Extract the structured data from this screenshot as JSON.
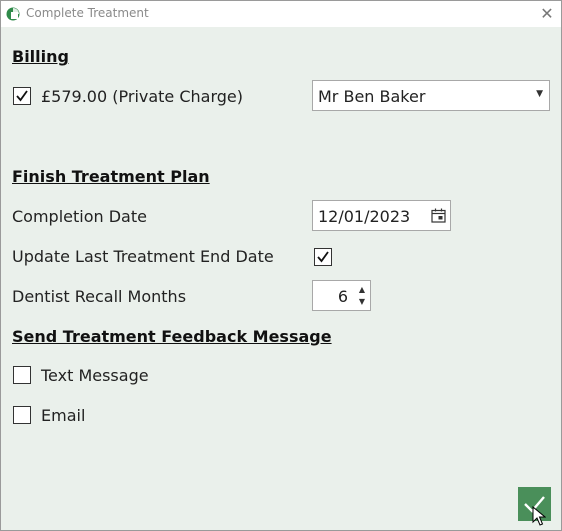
{
  "window": {
    "title": "Complete Treatment",
    "close_glyph": "✕",
    "app_icon": "app-logo-icon"
  },
  "billing": {
    "heading": "Billing",
    "charge_checked": true,
    "charge_label": "£579.00 (Private Charge)",
    "patient_selected": "Mr Ben Baker",
    "dropdown_arrow": "▼"
  },
  "finish_plan": {
    "heading": "Finish Treatment Plan",
    "completion_date_label": "Completion Date",
    "completion_date_value": "12/01/2023",
    "update_last_label": "Update Last Treatment End Date",
    "update_last_checked": true,
    "recall_label": "Dentist Recall Months",
    "recall_value": "6"
  },
  "feedback": {
    "heading": "Send Treatment Feedback Message",
    "text_message_label": "Text Message",
    "text_message_checked": false,
    "email_label": "Email",
    "email_checked": false
  },
  "colors": {
    "background": "#eaf0eb",
    "accent_green": "#4a8f5a"
  }
}
